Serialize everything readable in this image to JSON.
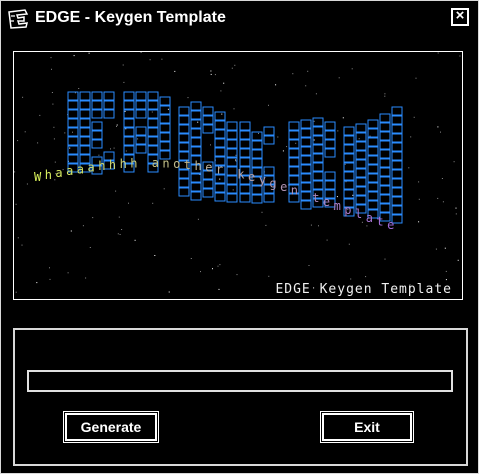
{
  "window": {
    "title": "EDGE - Keygen Template",
    "close_glyph": "×"
  },
  "banner": {
    "logo_text": "EDGE",
    "scroller_text": "Whaaaahhhh another keygen template",
    "caption": "EDGE Keygen Template",
    "colors": {
      "logo": "#2a8cff",
      "scroller_start": "#d9f25a",
      "scroller_end": "#a06ad8"
    }
  },
  "form": {
    "serial_value": "",
    "generate_label": "Generate",
    "exit_label": "Exit"
  }
}
